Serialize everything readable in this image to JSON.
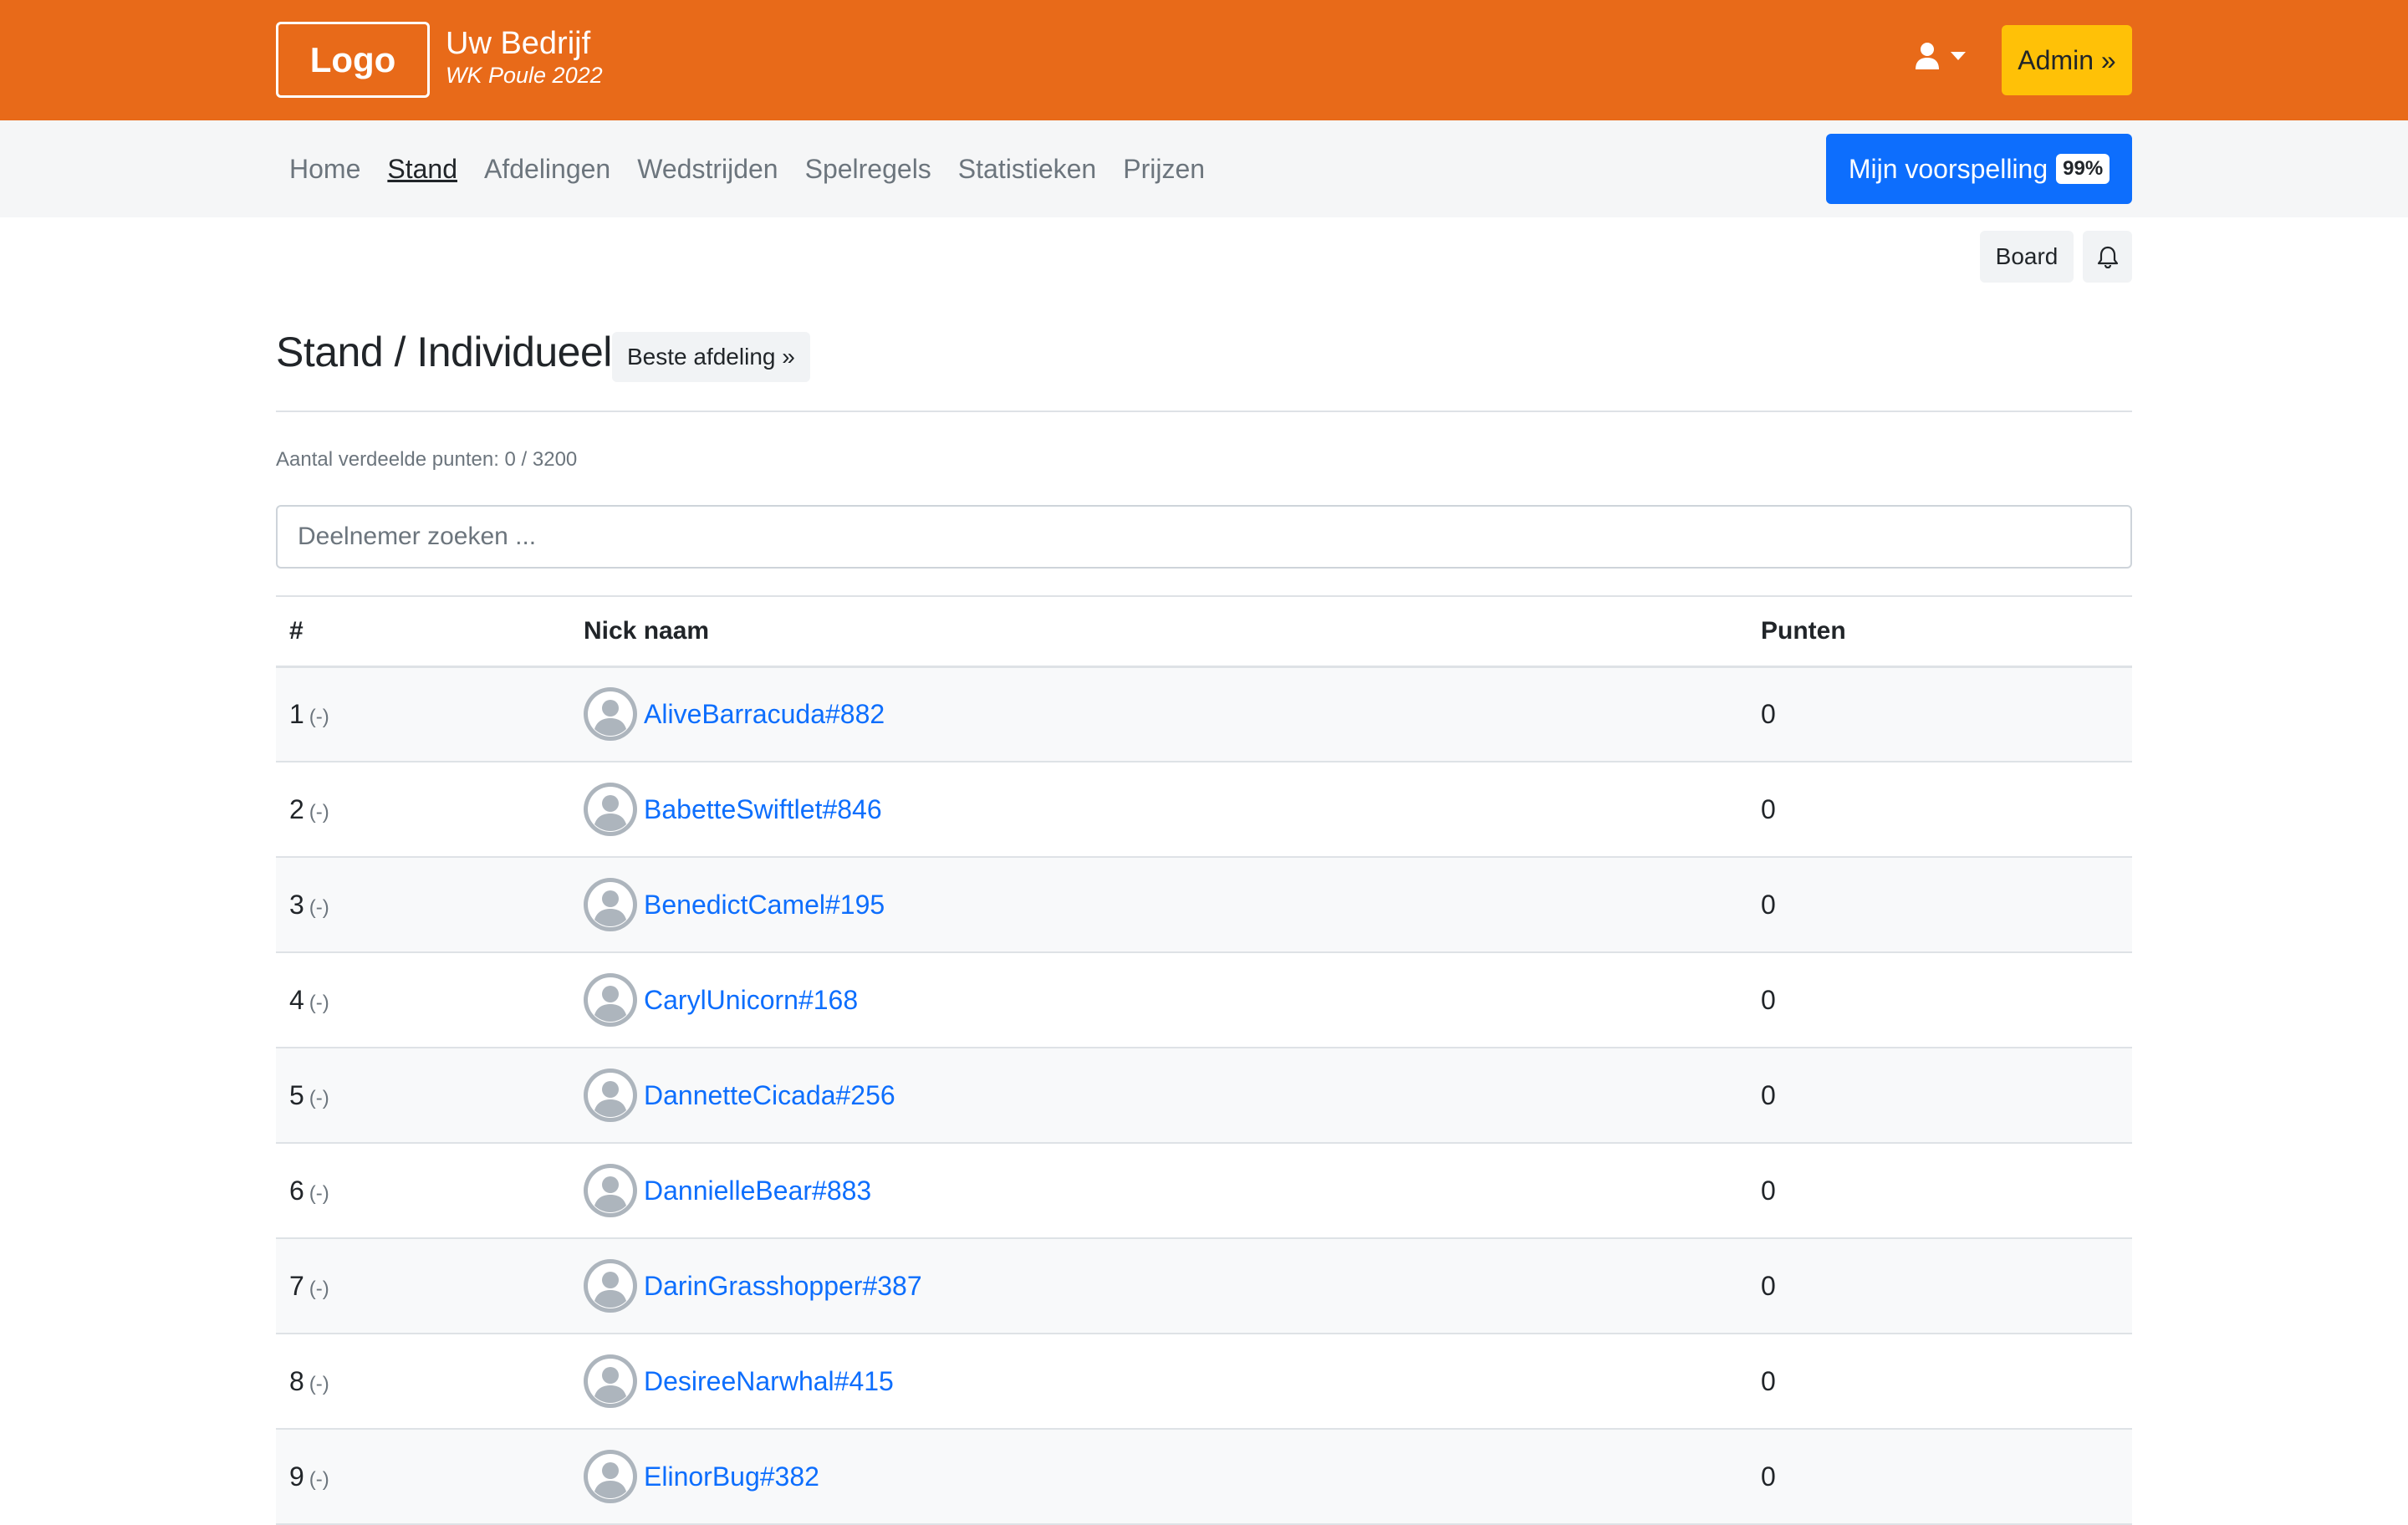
{
  "header": {
    "logo_text": "Logo",
    "company": "Uw Bedrijf",
    "subtitle": "WK Poule 2022",
    "admin_label": "Admin »"
  },
  "nav": {
    "items": [
      {
        "label": "Home"
      },
      {
        "label": "Stand"
      },
      {
        "label": "Afdelingen"
      },
      {
        "label": "Wedstrijden"
      },
      {
        "label": "Spelregels"
      },
      {
        "label": "Statistieken"
      },
      {
        "label": "Prijzen"
      }
    ],
    "active": "Stand",
    "cta_label": "Mijn voorspelling",
    "cta_badge": "99%"
  },
  "toolbar": {
    "board_label": "Board"
  },
  "page": {
    "title": "Stand / Individueel",
    "best_label": "Beste afdeling »",
    "points_info": "Aantal verdeelde punten: 0 / 3200",
    "search_placeholder": "Deelnemer zoeken ..."
  },
  "table": {
    "headers": {
      "rank": "#",
      "nick": "Nick naam",
      "points": "Punten"
    },
    "rows": [
      {
        "rank": "1",
        "change": "(-)",
        "nick": "AliveBarracuda#882",
        "points": "0"
      },
      {
        "rank": "2",
        "change": "(-)",
        "nick": "BabetteSwiftlet#846",
        "points": "0"
      },
      {
        "rank": "3",
        "change": "(-)",
        "nick": "BenedictCamel#195",
        "points": "0"
      },
      {
        "rank": "4",
        "change": "(-)",
        "nick": "CarylUnicorn#168",
        "points": "0"
      },
      {
        "rank": "5",
        "change": "(-)",
        "nick": "DannetteCicada#256",
        "points": "0"
      },
      {
        "rank": "6",
        "change": "(-)",
        "nick": "DannielleBear#883",
        "points": "0"
      },
      {
        "rank": "7",
        "change": "(-)",
        "nick": "DarinGrasshopper#387",
        "points": "0"
      },
      {
        "rank": "8",
        "change": "(-)",
        "nick": "DesireeNarwhal#415",
        "points": "0"
      },
      {
        "rank": "9",
        "change": "(-)",
        "nick": "ElinorBug#382",
        "points": "0"
      }
    ]
  },
  "colors": {
    "brand": "#e86a19",
    "accent": "#0d6efd",
    "admin": "#ffc107"
  }
}
